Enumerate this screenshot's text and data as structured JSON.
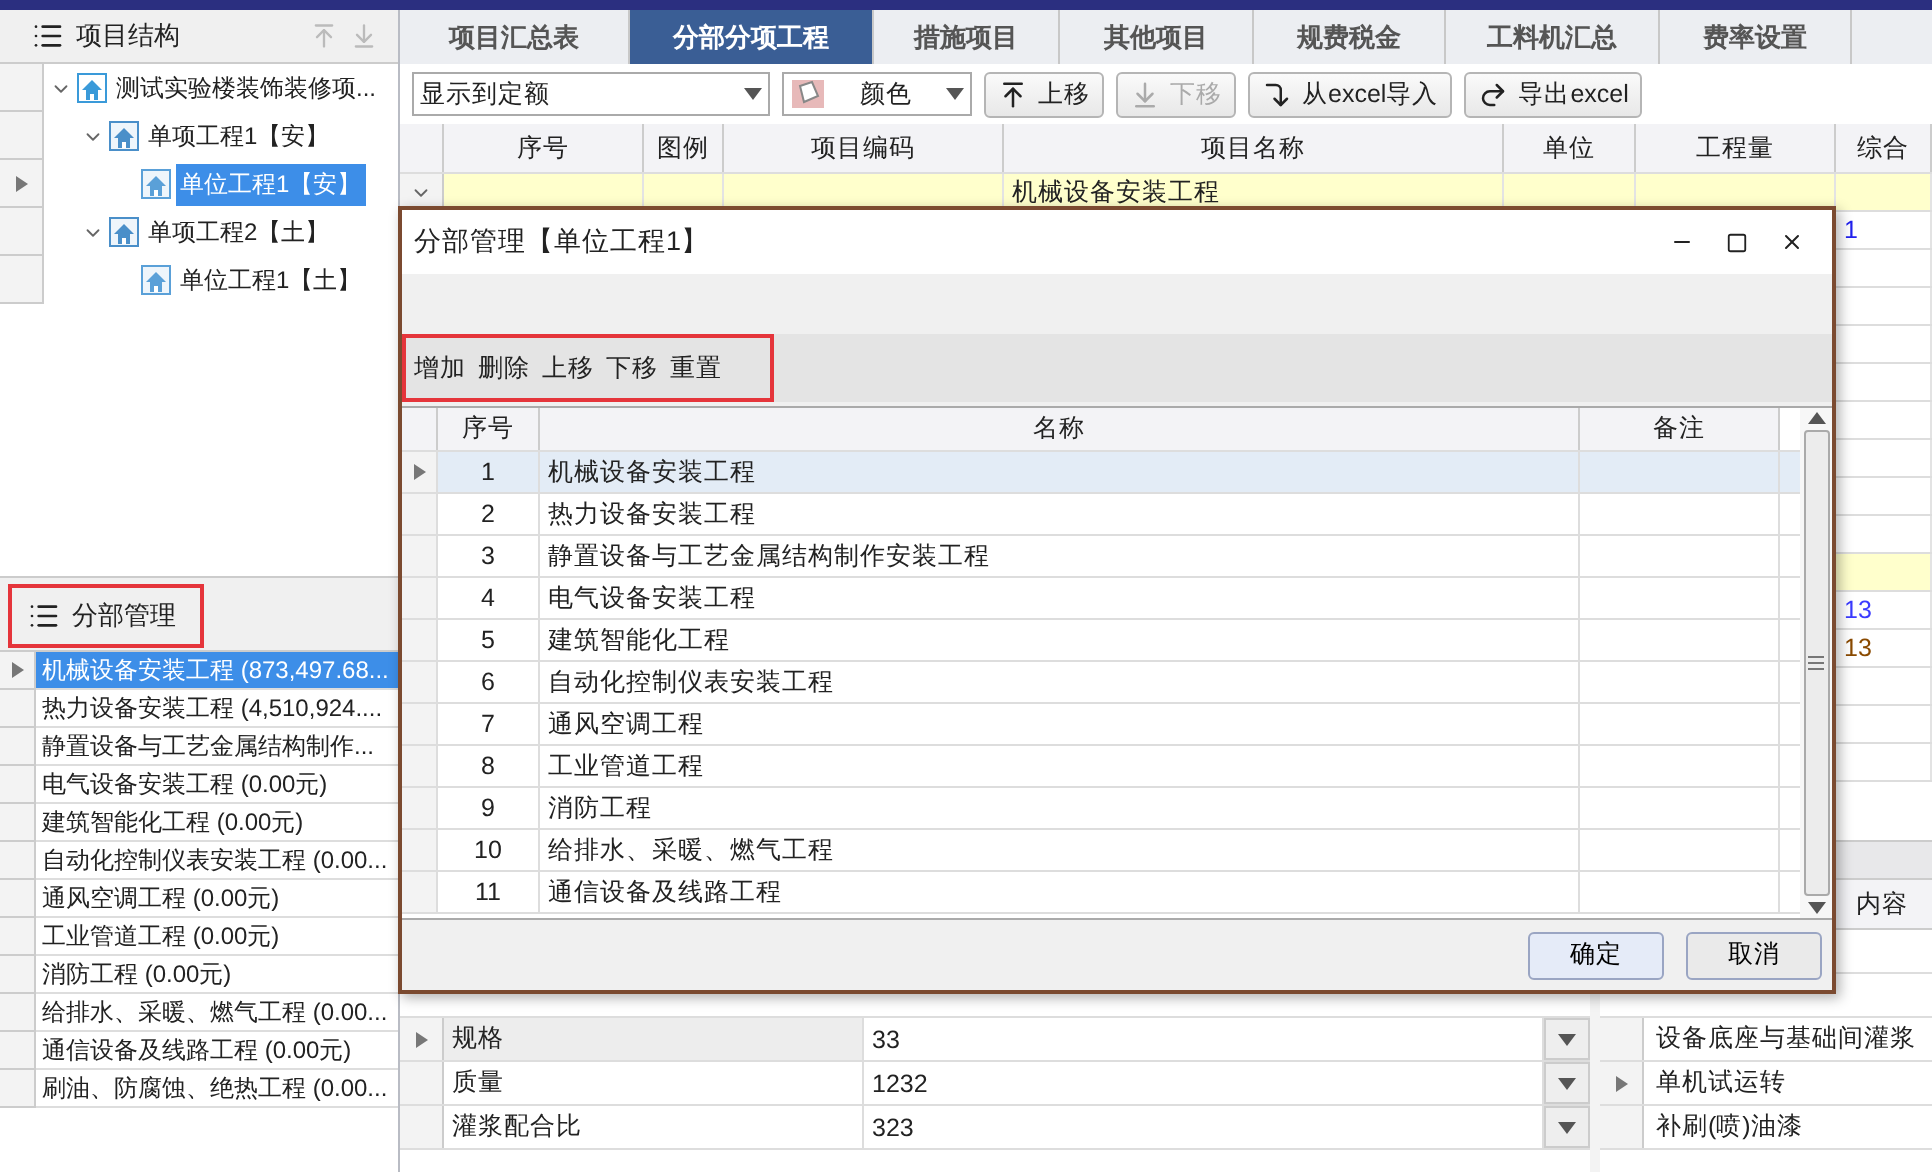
{
  "structure_panel": {
    "title": "项目结构",
    "tree": [
      {
        "label": "测试实验楼装饰装修项...",
        "kind": "project",
        "expanded": true,
        "selected": false,
        "children": [
          {
            "label": "单项工程1【安】",
            "kind": "single",
            "expanded": true,
            "selected": false,
            "children": [
              {
                "label": "单位工程1【安】",
                "kind": "unit",
                "selected": true
              }
            ]
          },
          {
            "label": "单项工程2【土】",
            "kind": "single",
            "expanded": true,
            "selected": false,
            "children": [
              {
                "label": "单位工程1【土】",
                "kind": "unit",
                "selected": false
              }
            ]
          }
        ]
      }
    ]
  },
  "division_panel": {
    "title": "分部管理",
    "items": [
      {
        "label": "机械设备安装工程 (873,497.68...",
        "selected": true
      },
      {
        "label": "热力设备安装工程 (4,510,924....",
        "selected": false
      },
      {
        "label": "静置设备与工艺金属结构制作...",
        "selected": false
      },
      {
        "label": "电气设备安装工程 (0.00元)",
        "selected": false
      },
      {
        "label": "建筑智能化工程 (0.00元)",
        "selected": false
      },
      {
        "label": "自动化控制仪表安装工程 (0.00...",
        "selected": false
      },
      {
        "label": "通风空调工程 (0.00元)",
        "selected": false
      },
      {
        "label": "工业管道工程 (0.00元)",
        "selected": false
      },
      {
        "label": "消防工程 (0.00元)",
        "selected": false
      },
      {
        "label": "给排水、采暖、燃气工程 (0.00...",
        "selected": false
      },
      {
        "label": "通信设备及线路工程 (0.00元)",
        "selected": false
      },
      {
        "label": "刷油、防腐蚀、绝热工程 (0.00...",
        "selected": false
      }
    ]
  },
  "tabs": [
    {
      "label": "项目汇总表",
      "selected": false
    },
    {
      "label": "分部分项工程",
      "selected": true
    },
    {
      "label": "措施项目",
      "selected": false
    },
    {
      "label": "其他项目",
      "selected": false
    },
    {
      "label": "规费税金",
      "selected": false
    },
    {
      "label": "工料机汇总",
      "selected": false
    },
    {
      "label": "费率设置",
      "selected": false
    }
  ],
  "toolbar": {
    "display_select": "显示到定额",
    "color_select": "颜色",
    "buttons": [
      {
        "label": "上移",
        "kind": "up",
        "disabled": false
      },
      {
        "label": "下移",
        "kind": "down",
        "disabled": true
      },
      {
        "label": "从excel导入",
        "kind": "import",
        "disabled": false
      },
      {
        "label": "导出excel",
        "kind": "export",
        "disabled": false
      }
    ]
  },
  "main_grid": {
    "columns": [
      "序号",
      "图例",
      "项目编码",
      "项目名称",
      "单位",
      "工程量",
      "综合"
    ],
    "rows": [
      {
        "kind": "section",
        "name": "机械设备安装工程"
      },
      {
        "kind": "item",
        "total": "1",
        "color": "#2222ee"
      },
      {
        "kind": "item"
      },
      {
        "kind": "item"
      },
      {
        "kind": "item"
      },
      {
        "kind": "item"
      },
      {
        "kind": "item"
      },
      {
        "kind": "item"
      },
      {
        "kind": "item"
      },
      {
        "kind": "item"
      },
      {
        "kind": "section"
      },
      {
        "kind": "item",
        "total": "13",
        "color": "#3b3bff"
      },
      {
        "kind": "item",
        "total": "13",
        "color": "#8a4a00"
      },
      {
        "kind": "item"
      },
      {
        "kind": "item"
      },
      {
        "kind": "item"
      }
    ]
  },
  "properties": [
    {
      "name": "规格",
      "value": "33",
      "selected": true
    },
    {
      "name": "质量",
      "value": "1232",
      "selected": false
    },
    {
      "name": "灌浆配合比",
      "value": "323",
      "selected": false
    }
  ],
  "content_list": {
    "title": "内容",
    "items": [
      {
        "label": "设备底座与基础间灌浆",
        "selected": false
      },
      {
        "label": "单机试运转",
        "selected": true
      },
      {
        "label": "补刷(喷)油漆",
        "selected": false
      }
    ]
  },
  "dialog": {
    "title": "分部管理【单位工程1】",
    "actions": [
      "增加",
      "删除",
      "上移",
      "下移",
      "重置"
    ],
    "columns": [
      "序号",
      "名称",
      "备注"
    ],
    "rows": [
      {
        "index": "1",
        "name": "机械设备安装工程",
        "selected": true
      },
      {
        "index": "2",
        "name": "热力设备安装工程",
        "selected": false
      },
      {
        "index": "3",
        "name": "静置设备与工艺金属结构制作安装工程",
        "selected": false
      },
      {
        "index": "4",
        "name": "电气设备安装工程",
        "selected": false
      },
      {
        "index": "5",
        "name": "建筑智能化工程",
        "selected": false
      },
      {
        "index": "6",
        "name": "自动化控制仪表安装工程",
        "selected": false
      },
      {
        "index": "7",
        "name": "通风空调工程",
        "selected": false
      },
      {
        "index": "8",
        "name": "工业管道工程",
        "selected": false
      },
      {
        "index": "9",
        "name": "消防工程",
        "selected": false
      },
      {
        "index": "10",
        "name": "给排水、采暖、燃气工程",
        "selected": false
      },
      {
        "index": "11",
        "name": "通信设备及线路工程",
        "selected": false
      }
    ],
    "buttons": [
      "确定",
      "取消"
    ]
  }
}
